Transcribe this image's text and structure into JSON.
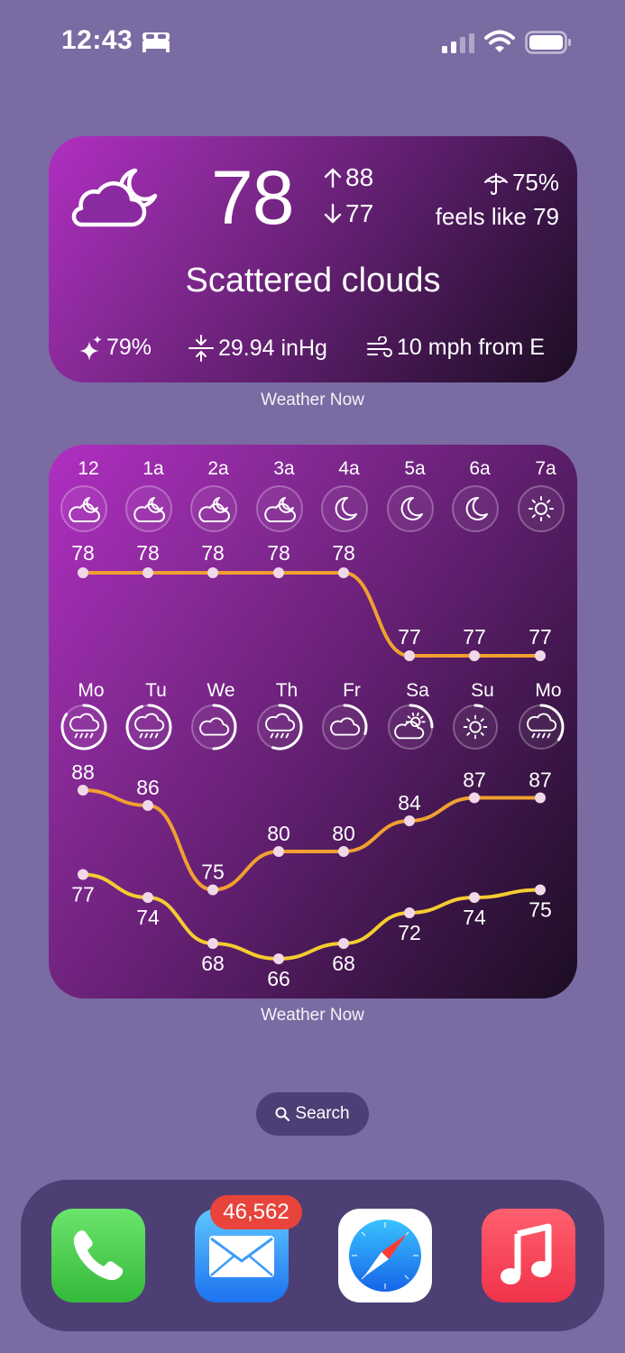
{
  "status_bar": {
    "time": "12:43",
    "icons": [
      "bed-icon",
      "cellular-signal-icon",
      "wifi-icon",
      "battery-icon"
    ]
  },
  "current_widget": {
    "condition_icon": "partly-cloudy-night-icon",
    "temperature": "78",
    "high": "88",
    "low": "77",
    "precip_chance": "75%",
    "feels_like": "feels like 79",
    "condition": "Scattered clouds",
    "humidity": "79%",
    "pressure": "29.94 inHg",
    "wind": "10 mph from E",
    "label": "Weather Now"
  },
  "forecast_widget": {
    "label": "Weather Now",
    "hours": [
      {
        "label": "12",
        "icon": "partly-cloudy-night-icon",
        "temp": 78
      },
      {
        "label": "1a",
        "icon": "partly-cloudy-night-icon",
        "temp": 78
      },
      {
        "label": "2a",
        "icon": "partly-cloudy-night-icon",
        "temp": 78
      },
      {
        "label": "3a",
        "icon": "partly-cloudy-night-icon",
        "temp": 78
      },
      {
        "label": "4a",
        "icon": "moon-icon",
        "temp": 78
      },
      {
        "label": "5a",
        "icon": "moon-icon",
        "temp": 77
      },
      {
        "label": "6a",
        "icon": "moon-icon",
        "temp": 77
      },
      {
        "label": "7a",
        "icon": "sun-icon",
        "temp": 77
      }
    ],
    "days": [
      {
        "label": "Mo",
        "icon": "rain-icon",
        "high": 88,
        "low": 77,
        "precip": 0.85
      },
      {
        "label": "Tu",
        "icon": "rain-icon",
        "high": 86,
        "low": 74,
        "precip": 0.95
      },
      {
        "label": "We",
        "icon": "cloud-icon",
        "high": 75,
        "low": 68,
        "precip": 0.5
      },
      {
        "label": "Th",
        "icon": "rain-icon",
        "high": 80,
        "low": 66,
        "precip": 0.55
      },
      {
        "label": "Fr",
        "icon": "cloud-icon",
        "high": 80,
        "low": 68,
        "precip": 0.3
      },
      {
        "label": "Sa",
        "icon": "partly-sunny-icon",
        "high": 84,
        "low": 72,
        "precip": 0.25
      },
      {
        "label": "Su",
        "icon": "sun-icon",
        "high": 87,
        "low": 74,
        "precip": 0.05
      },
      {
        "label": "Mo",
        "icon": "rain-icon",
        "high": 87,
        "low": 75,
        "precip": 0.35
      }
    ]
  },
  "search": {
    "label": "Search"
  },
  "dock": {
    "apps": [
      {
        "name": "Phone",
        "icon": "phone-icon"
      },
      {
        "name": "Mail",
        "icon": "mail-icon",
        "badge": "46,562"
      },
      {
        "name": "Safari",
        "icon": "safari-icon"
      },
      {
        "name": "Music",
        "icon": "music-icon"
      }
    ]
  },
  "colors": {
    "wallpaper": "#7a6ba3",
    "hourly_line": "#f0a030",
    "high_line": "#f0a030",
    "low_line": "#f5cc30",
    "badge": "#e8443c"
  }
}
